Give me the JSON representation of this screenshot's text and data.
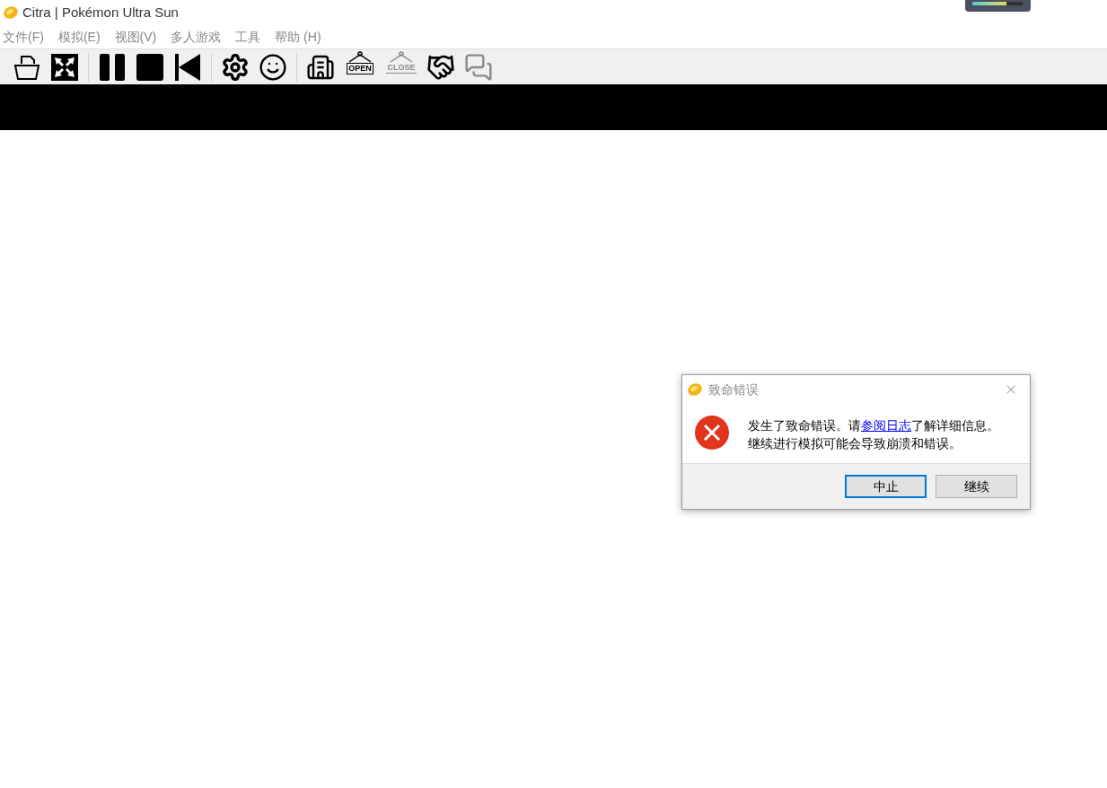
{
  "window": {
    "title": "Citra | Pokémon Ultra Sun"
  },
  "menu": [
    "文件(F)",
    "模拟(E)",
    "视图(V)",
    "多人游戏",
    "工具",
    "帮助 (H)"
  ],
  "toolbar": [
    [
      {
        "kind": "folder",
        "disabled": false
      },
      {
        "kind": "fullscreen",
        "disabled": false
      }
    ],
    [
      {
        "kind": "pause",
        "disabled": false
      },
      {
        "kind": "stop",
        "disabled": false
      },
      {
        "kind": "restart",
        "disabled": false
      }
    ],
    [
      {
        "kind": "settings",
        "disabled": false
      },
      {
        "kind": "smile",
        "disabled": false
      }
    ],
    [
      {
        "kind": "building",
        "disabled": false
      },
      {
        "kind": "sign",
        "label": "OPEN",
        "disabled": false
      },
      {
        "kind": "sign",
        "label": "CLOSE",
        "disabled": true
      },
      {
        "kind": "handshake",
        "disabled": false
      },
      {
        "kind": "chat",
        "disabled": true
      }
    ]
  ],
  "dialog": {
    "title": "致命错误",
    "message_before": "发生了致命错误。请",
    "link": "参阅日志",
    "message_after": "了解详细信息。",
    "message_line2": "继续进行模拟可能会导致崩溃和错误。",
    "buttons": [
      {
        "label": "中止",
        "selected": true
      },
      {
        "label": "继续",
        "selected": false
      }
    ]
  }
}
